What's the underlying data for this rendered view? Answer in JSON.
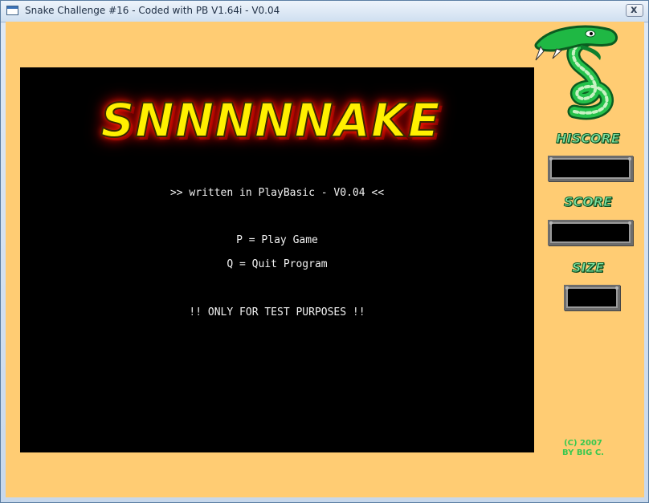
{
  "window": {
    "title": "Snake Challenge #16 - Coded with PB V1.64i - V0.04",
    "close_glyph": "x"
  },
  "game": {
    "logo": "SNNNNNAKE",
    "written_by": ">> written in PlayBasic - V0.04 <<",
    "menu_play": "P = Play Game",
    "menu_quit": "Q = Quit Program",
    "warning": "!! ONLY FOR TEST PURPOSES !!"
  },
  "sidebar": {
    "hiscore_label": "HISCORE",
    "score_label": "SCORE",
    "size_label": "SIZE",
    "credits_line1": "(C) 2007",
    "credits_line2": "BY BIG C."
  },
  "colors": {
    "background": "#ffcc73",
    "game_area": "#000000",
    "logo_text": "#fff000",
    "logo_glow": "#e00000",
    "label_green": "#7fe2a2"
  },
  "icons": {
    "window_icon": "app-window-icon",
    "snake": "green-snake-logo"
  }
}
